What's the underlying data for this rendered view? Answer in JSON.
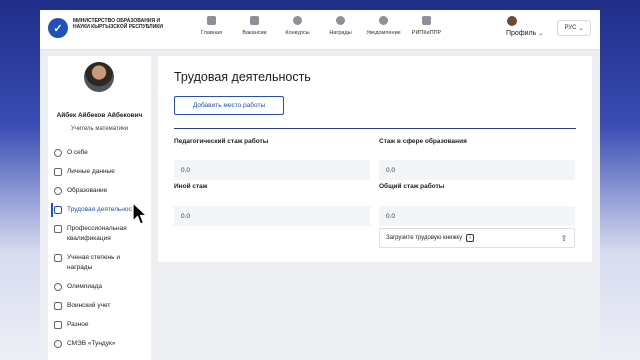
{
  "header": {
    "ministry_name": "МИНИСТЕРСТВО ОБРАЗОВАНИЯ И НАУКИ КЫРГЫЗСКОЙ РЕСПУБЛИКИ",
    "nav": [
      {
        "label": "Главная",
        "icon": "home-icon"
      },
      {
        "label": "Вакансии",
        "icon": "briefcase-icon"
      },
      {
        "label": "Конкурсы",
        "icon": "award-icon"
      },
      {
        "label": "Награды",
        "icon": "medal-icon"
      },
      {
        "label": "Уведомление",
        "icon": "bell-icon"
      },
      {
        "label": "РИПКиППР",
        "icon": "building-icon"
      }
    ],
    "profile_label": "Профиль",
    "language": "РУС"
  },
  "sidebar": {
    "user_name": "Айбек Айбеков Айбекович",
    "user_role": "Учитель математики",
    "items": [
      {
        "label": "О себе",
        "icon": "person-icon"
      },
      {
        "label": "Личные данные",
        "icon": "id-card-icon"
      },
      {
        "label": "Образование",
        "icon": "graduation-cap-icon"
      },
      {
        "label": "Трудовая деятельность",
        "icon": "briefcase-icon",
        "active": true
      },
      {
        "label": "Профессиональная квалификация",
        "icon": "certificate-icon"
      },
      {
        "label": "Ученая степень и награды",
        "icon": "diploma-icon"
      },
      {
        "label": "Олимпиада",
        "icon": "trophy-icon"
      },
      {
        "label": "Воинский учет",
        "icon": "document-icon"
      },
      {
        "label": "Разное",
        "icon": "grid-icon"
      },
      {
        "label": "СМЭВ «Тундук»",
        "icon": "gear-icon"
      }
    ]
  },
  "main": {
    "title": "Трудовая деятельность",
    "add_button": "Добавить место работы",
    "fields": {
      "teaching_exp_label": "Педагогический стаж работы",
      "teaching_exp_value": "0.0",
      "education_exp_label": "Стаж в сфере образования",
      "education_exp_value": "0.0",
      "other_exp_label": "Иной стаж",
      "other_exp_value": "0.0",
      "total_exp_label": "Общий стаж работы",
      "total_exp_value": "0.0"
    },
    "upload_label": "Загрузите трудовую книжку",
    "info_glyph": "i"
  },
  "colors": {
    "accent": "#2350b8",
    "divider": "#2c3f8c"
  }
}
